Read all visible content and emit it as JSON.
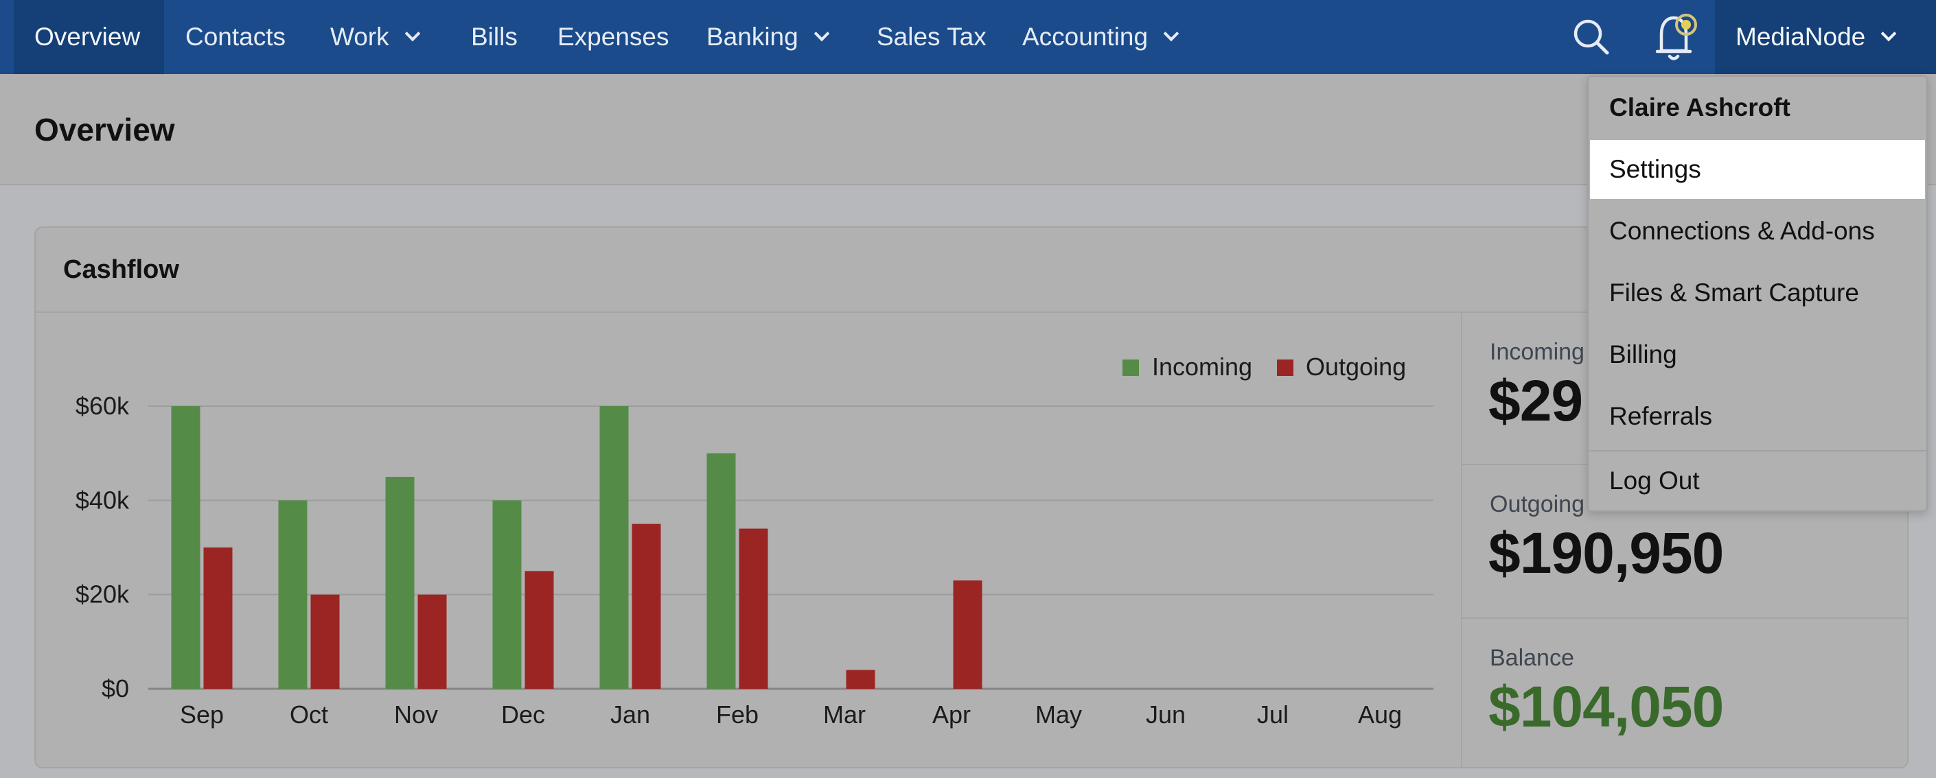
{
  "nav": {
    "items": [
      {
        "label": "Overview",
        "active": true
      },
      {
        "label": "Contacts"
      },
      {
        "label": "Work",
        "dropdown": true
      },
      {
        "label": "Bills"
      },
      {
        "label": "Expenses"
      },
      {
        "label": "Banking",
        "dropdown": true
      },
      {
        "label": "Sales Tax"
      },
      {
        "label": "Accounting",
        "dropdown": true
      }
    ],
    "search_icon": "search-icon",
    "notification_icon": "bell-icon",
    "account_label": "MediaNode"
  },
  "page": {
    "title": "Overview"
  },
  "cashflow": {
    "title": "Cashflow",
    "stats": {
      "incoming_label": "Incoming",
      "incoming_value": "$29",
      "outgoing_label": "Outgoing",
      "outgoing_value": "$190,950",
      "balance_label": "Balance",
      "balance_value": "$104,050"
    }
  },
  "chart_data": {
    "type": "bar",
    "categories": [
      "Sep",
      "Oct",
      "Nov",
      "Dec",
      "Jan",
      "Feb",
      "Mar",
      "Apr",
      "May",
      "Jun",
      "Jul",
      "Aug"
    ],
    "series": [
      {
        "name": "Incoming",
        "color": "#548c47",
        "values": [
          60000,
          40000,
          45000,
          40000,
          60000,
          50000,
          0,
          0,
          0,
          0,
          0,
          0
        ]
      },
      {
        "name": "Outgoing",
        "color": "#9b2522",
        "values": [
          30000,
          20000,
          20000,
          25000,
          35000,
          34000,
          4000,
          23000,
          0,
          0,
          0,
          0
        ]
      }
    ],
    "yticks": [
      {
        "value": 0,
        "label": "$0"
      },
      {
        "value": 20000,
        "label": "$20k"
      },
      {
        "value": 40000,
        "label": "$40k"
      },
      {
        "value": 60000,
        "label": "$60k"
      }
    ],
    "ylim": [
      0,
      60000
    ],
    "grid": true,
    "legend": "top-right"
  },
  "dropdown": {
    "user_name": "Claire Ashcroft",
    "items": [
      {
        "label": "Settings",
        "highlighted": true
      },
      {
        "label": "Connections & Add-ons"
      },
      {
        "label": "Files & Smart Capture"
      },
      {
        "label": "Billing"
      },
      {
        "label": "Referrals"
      }
    ],
    "logout_label": "Log Out"
  }
}
